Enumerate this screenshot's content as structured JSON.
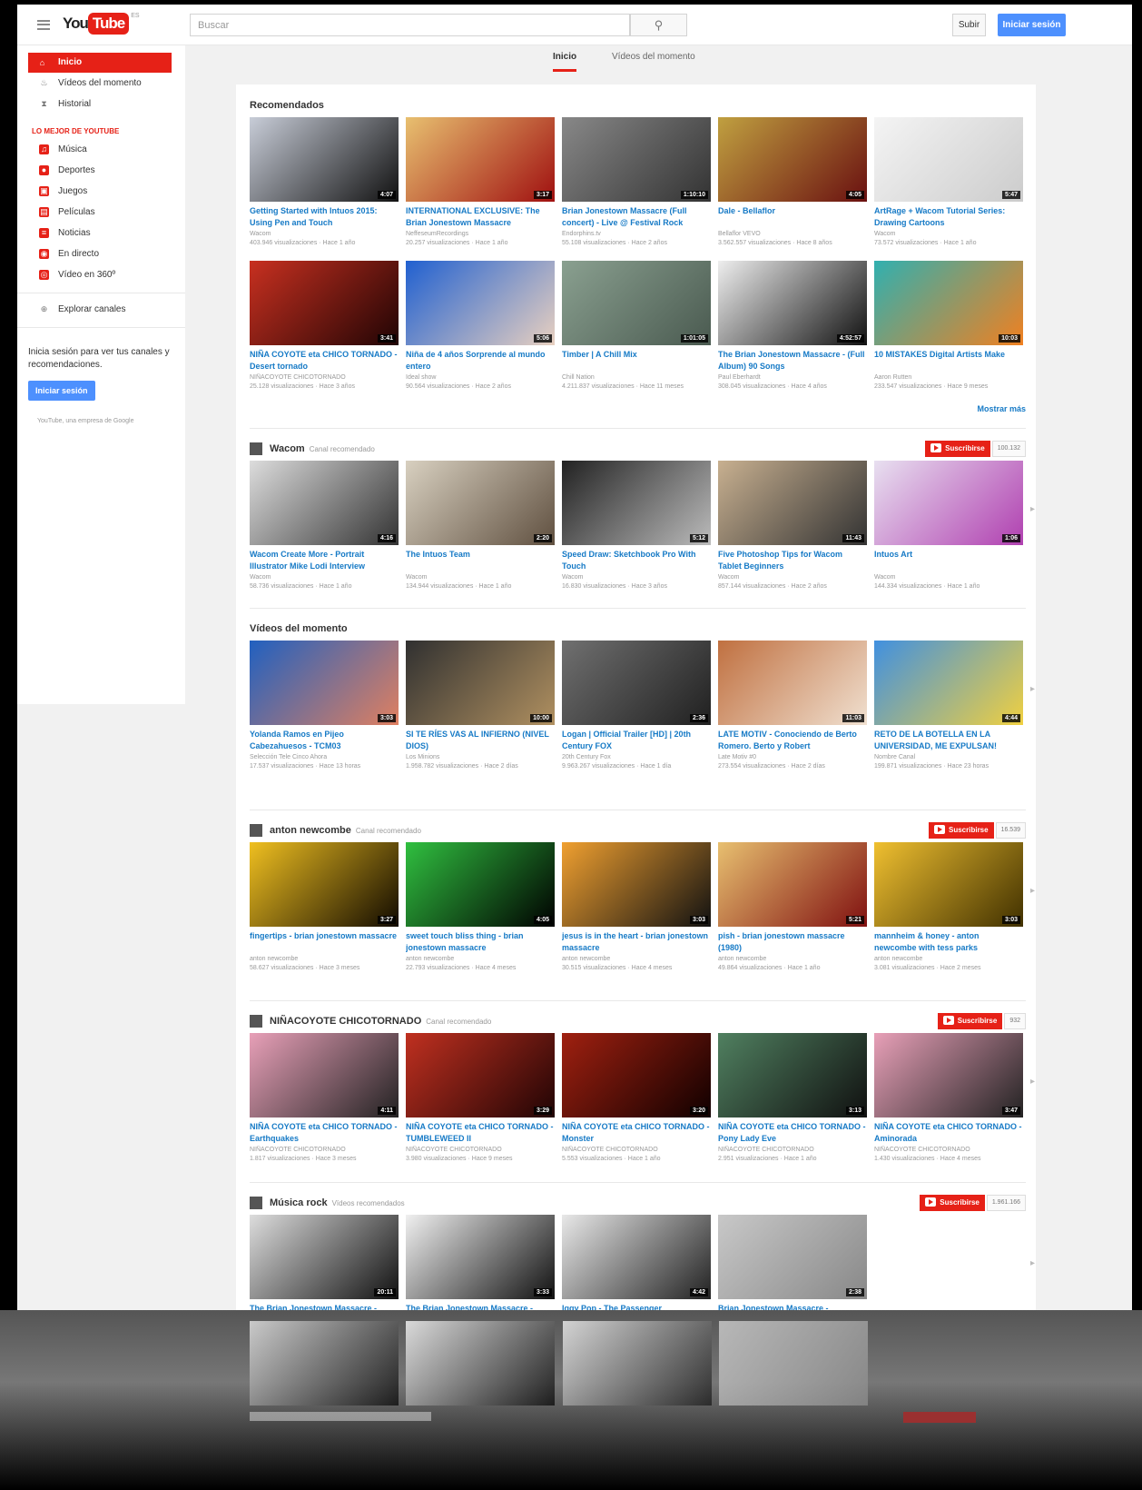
{
  "header": {
    "logo_you": "You",
    "logo_tube": "Tube",
    "logo_suffix": "ES",
    "search_placeholder": "Buscar",
    "upload": "Subir",
    "signin": "Iniciar sesión"
  },
  "sidebar": {
    "items": [
      {
        "label": "Inicio",
        "icon": "home-icon"
      },
      {
        "label": "Vídeos del momento",
        "icon": "flame-icon"
      },
      {
        "label": "Historial",
        "icon": "hourglass-icon"
      }
    ],
    "best_heading": "Lo mejor de YouTube",
    "categories": [
      {
        "label": "Música",
        "icon": "music-icon"
      },
      {
        "label": "Deportes",
        "icon": "sports-icon"
      },
      {
        "label": "Juegos",
        "icon": "gamepad-icon"
      },
      {
        "label": "Películas",
        "icon": "film-icon"
      },
      {
        "label": "Noticias",
        "icon": "news-icon"
      },
      {
        "label": "En directo",
        "icon": "live-icon"
      },
      {
        "label": "Vídeo en 360º",
        "icon": "360-icon"
      }
    ],
    "browse": {
      "label": "Explorar canales",
      "icon": "plus-circle-icon"
    },
    "promo": "Inicia sesión para ver tus canales y recomendaciones.",
    "promo_button": "Iniciar sesión",
    "footer": "YouTube, una empresa de Google"
  },
  "tabs": {
    "home": "Inicio",
    "trending": "Vídeos del momento"
  },
  "shelves": [
    {
      "title": "Recomendados",
      "subtitle": "",
      "rows": [
        [
          {
            "title": "Getting Started with Intuos 2015: Using Pen and Touch",
            "channel": "Wacom",
            "meta": "403.946 visualizaciones · Hace 1 año",
            "duration": "4:07",
            "colors": [
              "#c8cdd8",
              "#111"
            ]
          },
          {
            "title": "INTERNATIONAL EXCLUSIVE: The Brian Jonestown Massacre",
            "channel": "NeffeseumRecordings",
            "meta": "20.257 visualizaciones · Hace 1 año",
            "duration": "3:17",
            "colors": [
              "#e8c070",
              "#a01010"
            ]
          },
          {
            "title": "Brian Jonestown Massacre (Full concert) - Live @ Festival Rock",
            "channel": "Endorphins.tv",
            "meta": "55.108 visualizaciones · Hace 2 años",
            "duration": "1:10:10",
            "colors": [
              "#888",
              "#333"
            ]
          },
          {
            "title": "Dale - Bellaflor",
            "channel": "Bellaflor VEVO",
            "meta": "3.562.557 visualizaciones · Hace 8 años",
            "duration": "4:05",
            "colors": [
              "#c0a040",
              "#6a1010"
            ]
          },
          {
            "title": "ArtRage + Wacom Tutorial Series: Drawing Cartoons",
            "channel": "Wacom",
            "meta": "73.572 visualizaciones · Hace 1 año",
            "duration": "5:47",
            "colors": [
              "#f4f4f4",
              "#ccc"
            ]
          }
        ],
        [
          {
            "title": "NIÑA COYOTE eta CHICO TORNADO - Desert tornado",
            "channel": "NIÑACOYOTE CHICOTORNADO",
            "meta": "25.128 visualizaciones · Hace 3 años",
            "duration": "3:41",
            "colors": [
              "#c83020",
              "#200404"
            ]
          },
          {
            "title": "Niña de 4 años Sorprende al mundo entero",
            "channel": "Ideal show",
            "meta": "90.564 visualizaciones · Hace 2 años",
            "duration": "5:06",
            "colors": [
              "#2060d0",
              "#e8d0c0"
            ]
          },
          {
            "title": "Timber | A Chill Mix",
            "channel": "Chill Nation",
            "meta": "4.211.837 visualizaciones · Hace 11 meses",
            "duration": "1:01:05",
            "colors": [
              "#8aa090",
              "#4a5a50"
            ]
          },
          {
            "title": "The Brian Jonestown Massacre - (Full Album) 90 Songs",
            "channel": "Paul Eberhardt",
            "meta": "308.045 visualizaciones · Hace 4 años",
            "duration": "4:52:57",
            "colors": [
              "#eee",
              "#111"
            ]
          },
          {
            "title": "10 MISTAKES Digital Artists Make",
            "channel": "Aaron Rutten",
            "meta": "233.547 visualizaciones · Hace 9 meses",
            "duration": "10:03",
            "colors": [
              "#30b0b0",
              "#f08020"
            ]
          }
        ]
      ],
      "more": "Mostrar más"
    },
    {
      "title": "Wacom",
      "subtitle": "Canal recomendado",
      "subscribe": "Suscribirse",
      "count": "100.132",
      "rows": [
        [
          {
            "title": "Wacom Create More - Portrait Illustrator Mike Lodi Interview",
            "channel": "Wacom",
            "meta": "58.736 visualizaciones · Hace 1 año",
            "duration": "4:16",
            "colors": [
              "#ddd",
              "#333"
            ]
          },
          {
            "title": "The Intuos Team",
            "channel": "Wacom",
            "meta": "134.944 visualizaciones · Hace 1 año",
            "duration": "2:20",
            "colors": [
              "#d8d0c0",
              "#605040"
            ]
          },
          {
            "title": "Speed Draw: Sketchbook Pro With Touch",
            "channel": "Wacom",
            "meta": "16.830 visualizaciones · Hace 3 años",
            "duration": "5:12",
            "colors": [
              "#222",
              "#bbb"
            ]
          },
          {
            "title": "Five Photoshop Tips for Wacom Tablet Beginners",
            "channel": "Wacom",
            "meta": "857.144 visualizaciones · Hace 2 años",
            "duration": "11:43",
            "colors": [
              "#c8b090",
              "#333"
            ]
          },
          {
            "title": "Intuos Art",
            "channel": "Wacom",
            "meta": "144.334 visualizaciones · Hace 1 año",
            "duration": "1:06",
            "colors": [
              "#e8e0f0",
              "#b040b0"
            ]
          }
        ]
      ]
    },
    {
      "title": "Vídeos del momento",
      "subtitle": "",
      "rows": [
        [
          {
            "title": "Yolanda Ramos en Pijeo Cabezahuesos - TCM03",
            "channel": "Selección Tele Cinco Ahora",
            "meta": "17.537 visualizaciones · Hace 13 horas",
            "duration": "3:03",
            "colors": [
              "#2060c0",
              "#e08060"
            ]
          },
          {
            "title": "SI TE RÍES VAS AL INFIERNO (NIVEL DIOS)",
            "channel": "Los Minions",
            "meta": "1.958.782 visualizaciones · Hace 2 días",
            "duration": "10:00",
            "colors": [
              "#303030",
              "#b09060"
            ]
          },
          {
            "title": "Logan | Official Trailer [HD] | 20th Century FOX",
            "channel": "20th Century Fox",
            "meta": "9.963.267 visualizaciones · Hace 1 día",
            "duration": "2:36",
            "colors": [
              "#707070",
              "#202020"
            ]
          },
          {
            "title": "LATE MOTIV - Conociendo de Berto Romero. Berto y Robert",
            "channel": "Late Motiv #0",
            "meta": "273.554 visualizaciones · Hace 2 días",
            "duration": "11:03",
            "colors": [
              "#c07040",
              "#f0e0d0"
            ]
          },
          {
            "title": "RETO DE LA BOTELLA EN LA UNIVERSIDAD, ME EXPULSAN!",
            "channel": "Nombre Canal",
            "meta": "199.871 visualizaciones · Hace 23 horas",
            "duration": "4:44",
            "colors": [
              "#4090e0",
              "#f0d040"
            ]
          }
        ]
      ]
    },
    {
      "title": "anton newcombe",
      "subtitle": "Canal recomendado",
      "subscribe": "Suscribirse",
      "count": "16.539",
      "rows": [
        [
          {
            "title": "fingertips - brian jonestown massacre",
            "channel": "anton newcombe",
            "meta": "58.627 visualizaciones · Hace 3 meses",
            "duration": "3:27",
            "colors": [
              "#f0c020",
              "#110a00"
            ]
          },
          {
            "title": "sweet touch bliss thing - brian jonestown massacre",
            "channel": "anton newcombe",
            "meta": "22.793 visualizaciones · Hace 4 meses",
            "duration": "4:05",
            "colors": [
              "#30c040",
              "#000"
            ]
          },
          {
            "title": "jesus is in the heart - brian jonestown massacre",
            "channel": "anton newcombe",
            "meta": "30.515 visualizaciones · Hace 4 meses",
            "duration": "3:03",
            "colors": [
              "#f0a030",
              "#111"
            ]
          },
          {
            "title": "pish - brian jonestown massacre (1980)",
            "channel": "anton newcombe",
            "meta": "49.864 visualizaciones · Hace 1 año",
            "duration": "5:21",
            "colors": [
              "#e8c070",
              "#801010"
            ]
          },
          {
            "title": "mannheim & honey - anton newcombe with tess parks",
            "channel": "anton newcombe",
            "meta": "3.081 visualizaciones · Hace 2 meses",
            "duration": "3:03",
            "colors": [
              "#f0c030",
              "#403000"
            ]
          }
        ]
      ]
    },
    {
      "title": "NIÑACOYOTE CHICOTORNADO",
      "subtitle": "Canal recomendado",
      "subscribe": "Suscribirse",
      "count": "932",
      "rows": [
        [
          {
            "title": "NIÑA COYOTE eta CHICO TORNADO - Earthquakes",
            "channel": "NIÑACOYOTE CHICOTORNADO",
            "meta": "1.817 visualizaciones · Hace 3 meses",
            "duration": "4:11",
            "colors": [
              "#e8a0b8",
              "#222"
            ]
          },
          {
            "title": "NIÑA COYOTE eta CHICO TORNADO - TUMBLEWEED II",
            "channel": "NIÑACOYOTE CHICOTORNADO",
            "meta": "3.980 visualizaciones · Hace 9 meses",
            "duration": "3:29",
            "colors": [
              "#c03020",
              "#200404"
            ]
          },
          {
            "title": "NIÑA COYOTE eta CHICO TORNADO - Monster",
            "channel": "NIÑACOYOTE CHICOTORNADO",
            "meta": "5.553 visualizaciones · Hace 1 año",
            "duration": "3:20",
            "colors": [
              "#a02010",
              "#100000"
            ]
          },
          {
            "title": "NIÑA COYOTE eta CHICO TORNADO - Pony Lady Eve",
            "channel": "NIÑACOYOTE CHICOTORNADO",
            "meta": "2.951 visualizaciones · Hace 1 año",
            "duration": "3:13",
            "colors": [
              "#508060",
              "#101010"
            ]
          },
          {
            "title": "NIÑA COYOTE eta CHICO TORNADO - Aminorada",
            "channel": "NIÑACOYOTE CHICOTORNADO",
            "meta": "1.430 visualizaciones · Hace 4 meses",
            "duration": "3:47",
            "colors": [
              "#e8a0b8",
              "#222"
            ]
          }
        ]
      ]
    },
    {
      "title": "Música rock",
      "subtitle": "Vídeos recomendados",
      "subscribe": "Suscribirse",
      "count": "1.961.166",
      "rows": [
        [
          {
            "title": "The Brian Jonestown Massacre -",
            "channel": "",
            "meta": "",
            "duration": "20:11",
            "colors": [
              "#ddd",
              "#111"
            ]
          },
          {
            "title": "The Brian Jonestown Massacre -",
            "channel": "",
            "meta": "",
            "duration": "3:33",
            "colors": [
              "#f0f0f0",
              "#111"
            ]
          },
          {
            "title": "Iggy Pop - The Passenger",
            "channel": "",
            "meta": "",
            "duration": "4:42",
            "colors": [
              "#e8e8e8",
              "#222"
            ]
          },
          {
            "title": "Brian Jonestown Massacre -",
            "channel": "",
            "meta": "",
            "duration": "2:38",
            "colors": [
              "#c8c8c8",
              "#888"
            ]
          }
        ]
      ]
    }
  ]
}
